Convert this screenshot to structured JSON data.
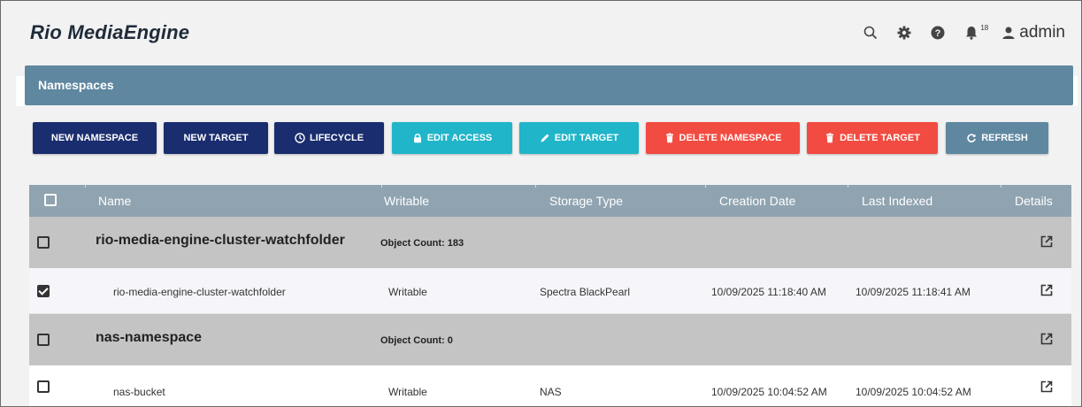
{
  "app": {
    "title": "Rio MediaEngine"
  },
  "header": {
    "notifications_count": "18",
    "user": "admin"
  },
  "panel": {
    "title": "Namespaces"
  },
  "toolbar": {
    "new_namespace": "NEW NAMESPACE",
    "new_target": "NEW TARGET",
    "lifecycle": "LIFECYCLE",
    "edit_access": "EDIT ACCESS",
    "edit_target": "EDIT TARGET",
    "delete_namespace": "DELETE NAMESPACE",
    "delete_target": "DELETE TARGET",
    "refresh": "REFRESH"
  },
  "colors": {
    "navy": "#1a2d6e",
    "teal": "#20b5c8",
    "red": "#f24b41",
    "steel": "#5f87a0",
    "header_row": "#8fa3b0",
    "group_row": "#c4c4c4"
  },
  "table": {
    "columns": [
      "Name",
      "Writable",
      "Storage Type",
      "Creation Date",
      "Last Indexed",
      "Details"
    ],
    "rows": [
      {
        "type": "group",
        "checked": false,
        "name": "rio-media-engine-cluster-watchfolder",
        "object_count": "Object Count: 183"
      },
      {
        "type": "child",
        "checked": true,
        "name": "rio-media-engine-cluster-watchfolder",
        "writable": "Writable",
        "storage_type": "Spectra BlackPearl",
        "creation_date": "10/09/2025 11:18:40 AM",
        "last_indexed": "10/09/2025 11:18:41 AM"
      },
      {
        "type": "group",
        "checked": false,
        "name": "nas-namespace",
        "object_count": "Object Count: 0"
      },
      {
        "type": "child",
        "checked": false,
        "name": "nas-bucket",
        "writable": "Writable",
        "storage_type": "NAS",
        "creation_date": "10/09/2025 10:04:52 AM",
        "last_indexed": "10/09/2025 10:04:52 AM"
      }
    ]
  }
}
